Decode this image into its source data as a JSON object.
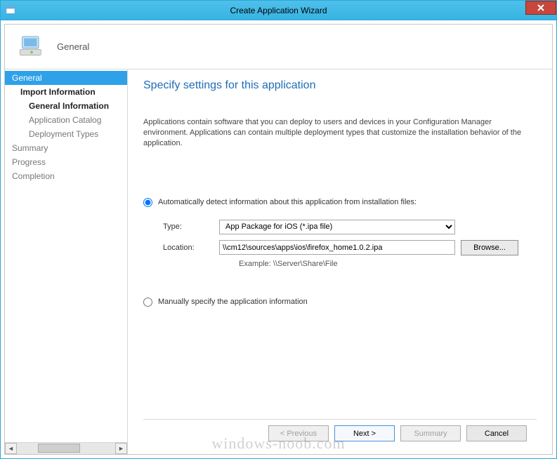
{
  "window": {
    "title": "Create Application Wizard"
  },
  "header": {
    "label": "General"
  },
  "sidebar": {
    "items": [
      {
        "label": "General",
        "level": 0,
        "state": "active"
      },
      {
        "label": "Import Information",
        "level": 1,
        "state": "bold"
      },
      {
        "label": "General Information",
        "level": 2,
        "state": "bold"
      },
      {
        "label": "Application Catalog",
        "level": 2,
        "state": "muted"
      },
      {
        "label": "Deployment Types",
        "level": 2,
        "state": "muted"
      },
      {
        "label": "Summary",
        "level": 0,
        "state": "muted"
      },
      {
        "label": "Progress",
        "level": 0,
        "state": "muted"
      },
      {
        "label": "Completion",
        "level": 0,
        "state": "muted"
      }
    ]
  },
  "main": {
    "title": "Specify settings for this application",
    "description": "Applications contain software that you can deploy to users and devices in your Configuration Manager environment. Applications can contain multiple deployment types that customize the installation behavior of the application.",
    "radio_auto_label": "Automatically detect information about this application from installation files:",
    "radio_manual_label": "Manually specify the application information",
    "type_label": "Type:",
    "type_value": "App Package for iOS (*.ipa file)",
    "location_label": "Location:",
    "location_value": "\\\\cm12\\sources\\apps\\ios\\firefox_home1.0.2.ipa",
    "example_label": "Example: \\\\Server\\Share\\File",
    "browse_label": "Browse..."
  },
  "footer": {
    "previous": "< Previous",
    "next": "Next >",
    "summary": "Summary",
    "cancel": "Cancel"
  },
  "watermark": "windows-noob.com"
}
